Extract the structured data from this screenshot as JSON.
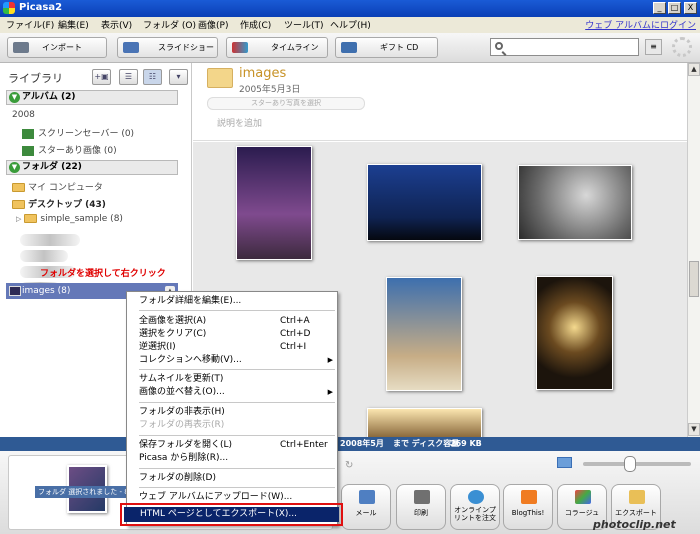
{
  "window": {
    "title": "Picasa2",
    "minimize": "_",
    "maximize": "□",
    "close": "X"
  },
  "menubar": {
    "items": [
      "ファイル(F)",
      "編集(E)",
      "表示(V)",
      "フォルダ (O)",
      "画像(P)",
      "作成(C)",
      "ツール(T)",
      "ヘルプ(H)"
    ],
    "web_album_link": "ウェブ アルバムにログイン"
  },
  "toolbar": {
    "import": "インポート",
    "slideshow": "スライドショー",
    "timeline": "タイムライン",
    "gift_cd": "ギフト CD",
    "search_placeholder": "",
    "search_clear": "≡"
  },
  "library": {
    "title": "ライブラリ",
    "album_group": "アルバム (2)",
    "year": "2008",
    "album_items": [
      "スクリーンセーバー (0)",
      "スターあり画像 (0)"
    ],
    "folder_group": "フォルダ (22)",
    "my_computer": "マイ コンピュータ",
    "desktop": "デスクトップ (43)",
    "simple_sample": "simple_sample (8)",
    "annotation": "フォルダを選択して右クリック",
    "selected_folder": "images (8)",
    "colors": {
      "selected_bg": "#6478b8",
      "annotation": "#e00000"
    }
  },
  "main": {
    "folder_name": "images",
    "folder_date": "2005年5月3日",
    "star_select": "スターあり写真を選択",
    "add_caption": "説明を追加"
  },
  "status": {
    "date": "2008年5月",
    "disk_label": "まで ディスク容量",
    "disk_size": "269 KB"
  },
  "tray": {
    "selected_text": "フォルダ 選択されました - 8 写",
    "buttons": [
      "メール",
      "印刷",
      "オンラインプリントを注文",
      "BlogThis!",
      "コラージュ",
      "エクスポート"
    ]
  },
  "context_menu": {
    "items": [
      {
        "label": "フォルダ詳細を編集(E)...",
        "shortcut": "",
        "disabled": false,
        "submenu": false
      },
      {
        "label": "全画像を選択(A)",
        "shortcut": "Ctrl+A",
        "disabled": false,
        "submenu": false
      },
      {
        "label": "選択をクリア(C)",
        "shortcut": "Ctrl+D",
        "disabled": false,
        "submenu": false
      },
      {
        "label": "逆選択(I)",
        "shortcut": "Ctrl+I",
        "disabled": false,
        "submenu": false
      },
      {
        "label": "コレクションへ移動(V)...",
        "shortcut": "",
        "disabled": false,
        "submenu": true
      },
      {
        "label": "サムネイルを更新(T)",
        "shortcut": "",
        "disabled": false,
        "submenu": false
      },
      {
        "label": "画像の並べ替え(O)...",
        "shortcut": "",
        "disabled": false,
        "submenu": true
      },
      {
        "label": "フォルダの非表示(H)",
        "shortcut": "",
        "disabled": false,
        "submenu": false
      },
      {
        "label": "フォルダの再表示(R)",
        "shortcut": "",
        "disabled": true,
        "submenu": false
      },
      {
        "label": "保存フォルダを開く(L)",
        "shortcut": "Ctrl+Enter",
        "disabled": false,
        "submenu": false
      },
      {
        "label": "Picasa から削除(R)...",
        "shortcut": "",
        "disabled": false,
        "submenu": false
      },
      {
        "label": "フォルダの削除(D)",
        "shortcut": "",
        "disabled": false,
        "submenu": false
      },
      {
        "label": "ウェブ アルバムにアップロード(W)...",
        "shortcut": "",
        "disabled": false,
        "submenu": false
      }
    ],
    "highlighted": "HTML ページとしてエクスポート(X)...",
    "colors": {
      "highlight_bg": "#0a246a",
      "callout_border": "#e01010"
    }
  },
  "watermark": "photoclip.net"
}
